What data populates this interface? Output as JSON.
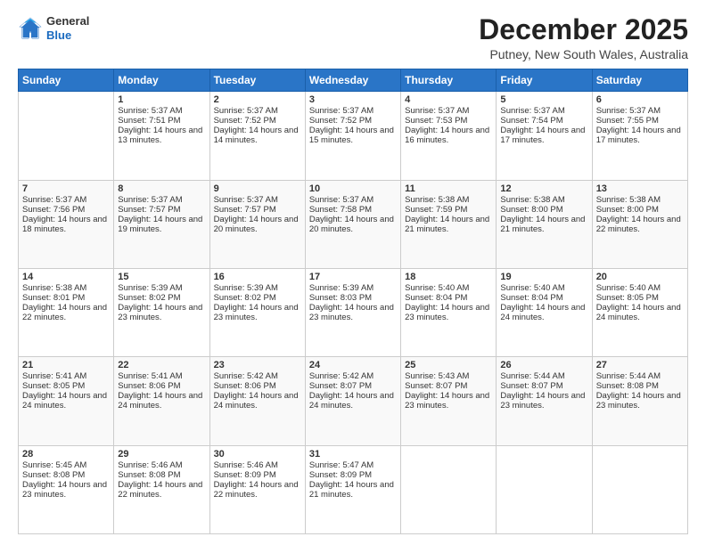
{
  "logo": {
    "general": "General",
    "blue": "Blue"
  },
  "title": "December 2025",
  "subtitle": "Putney, New South Wales, Australia",
  "days": [
    "Sunday",
    "Monday",
    "Tuesday",
    "Wednesday",
    "Thursday",
    "Friday",
    "Saturday"
  ],
  "weeks": [
    [
      {
        "day": "",
        "sunrise": "",
        "sunset": "",
        "daylight": ""
      },
      {
        "day": "1",
        "sunrise": "Sunrise: 5:37 AM",
        "sunset": "Sunset: 7:51 PM",
        "daylight": "Daylight: 14 hours and 13 minutes."
      },
      {
        "day": "2",
        "sunrise": "Sunrise: 5:37 AM",
        "sunset": "Sunset: 7:52 PM",
        "daylight": "Daylight: 14 hours and 14 minutes."
      },
      {
        "day": "3",
        "sunrise": "Sunrise: 5:37 AM",
        "sunset": "Sunset: 7:52 PM",
        "daylight": "Daylight: 14 hours and 15 minutes."
      },
      {
        "day": "4",
        "sunrise": "Sunrise: 5:37 AM",
        "sunset": "Sunset: 7:53 PM",
        "daylight": "Daylight: 14 hours and 16 minutes."
      },
      {
        "day": "5",
        "sunrise": "Sunrise: 5:37 AM",
        "sunset": "Sunset: 7:54 PM",
        "daylight": "Daylight: 14 hours and 17 minutes."
      },
      {
        "day": "6",
        "sunrise": "Sunrise: 5:37 AM",
        "sunset": "Sunset: 7:55 PM",
        "daylight": "Daylight: 14 hours and 17 minutes."
      }
    ],
    [
      {
        "day": "7",
        "sunrise": "Sunrise: 5:37 AM",
        "sunset": "Sunset: 7:56 PM",
        "daylight": "Daylight: 14 hours and 18 minutes."
      },
      {
        "day": "8",
        "sunrise": "Sunrise: 5:37 AM",
        "sunset": "Sunset: 7:57 PM",
        "daylight": "Daylight: 14 hours and 19 minutes."
      },
      {
        "day": "9",
        "sunrise": "Sunrise: 5:37 AM",
        "sunset": "Sunset: 7:57 PM",
        "daylight": "Daylight: 14 hours and 20 minutes."
      },
      {
        "day": "10",
        "sunrise": "Sunrise: 5:37 AM",
        "sunset": "Sunset: 7:58 PM",
        "daylight": "Daylight: 14 hours and 20 minutes."
      },
      {
        "day": "11",
        "sunrise": "Sunrise: 5:38 AM",
        "sunset": "Sunset: 7:59 PM",
        "daylight": "Daylight: 14 hours and 21 minutes."
      },
      {
        "day": "12",
        "sunrise": "Sunrise: 5:38 AM",
        "sunset": "Sunset: 8:00 PM",
        "daylight": "Daylight: 14 hours and 21 minutes."
      },
      {
        "day": "13",
        "sunrise": "Sunrise: 5:38 AM",
        "sunset": "Sunset: 8:00 PM",
        "daylight": "Daylight: 14 hours and 22 minutes."
      }
    ],
    [
      {
        "day": "14",
        "sunrise": "Sunrise: 5:38 AM",
        "sunset": "Sunset: 8:01 PM",
        "daylight": "Daylight: 14 hours and 22 minutes."
      },
      {
        "day": "15",
        "sunrise": "Sunrise: 5:39 AM",
        "sunset": "Sunset: 8:02 PM",
        "daylight": "Daylight: 14 hours and 23 minutes."
      },
      {
        "day": "16",
        "sunrise": "Sunrise: 5:39 AM",
        "sunset": "Sunset: 8:02 PM",
        "daylight": "Daylight: 14 hours and 23 minutes."
      },
      {
        "day": "17",
        "sunrise": "Sunrise: 5:39 AM",
        "sunset": "Sunset: 8:03 PM",
        "daylight": "Daylight: 14 hours and 23 minutes."
      },
      {
        "day": "18",
        "sunrise": "Sunrise: 5:40 AM",
        "sunset": "Sunset: 8:04 PM",
        "daylight": "Daylight: 14 hours and 23 minutes."
      },
      {
        "day": "19",
        "sunrise": "Sunrise: 5:40 AM",
        "sunset": "Sunset: 8:04 PM",
        "daylight": "Daylight: 14 hours and 24 minutes."
      },
      {
        "day": "20",
        "sunrise": "Sunrise: 5:40 AM",
        "sunset": "Sunset: 8:05 PM",
        "daylight": "Daylight: 14 hours and 24 minutes."
      }
    ],
    [
      {
        "day": "21",
        "sunrise": "Sunrise: 5:41 AM",
        "sunset": "Sunset: 8:05 PM",
        "daylight": "Daylight: 14 hours and 24 minutes."
      },
      {
        "day": "22",
        "sunrise": "Sunrise: 5:41 AM",
        "sunset": "Sunset: 8:06 PM",
        "daylight": "Daylight: 14 hours and 24 minutes."
      },
      {
        "day": "23",
        "sunrise": "Sunrise: 5:42 AM",
        "sunset": "Sunset: 8:06 PM",
        "daylight": "Daylight: 14 hours and 24 minutes."
      },
      {
        "day": "24",
        "sunrise": "Sunrise: 5:42 AM",
        "sunset": "Sunset: 8:07 PM",
        "daylight": "Daylight: 14 hours and 24 minutes."
      },
      {
        "day": "25",
        "sunrise": "Sunrise: 5:43 AM",
        "sunset": "Sunset: 8:07 PM",
        "daylight": "Daylight: 14 hours and 23 minutes."
      },
      {
        "day": "26",
        "sunrise": "Sunrise: 5:44 AM",
        "sunset": "Sunset: 8:07 PM",
        "daylight": "Daylight: 14 hours and 23 minutes."
      },
      {
        "day": "27",
        "sunrise": "Sunrise: 5:44 AM",
        "sunset": "Sunset: 8:08 PM",
        "daylight": "Daylight: 14 hours and 23 minutes."
      }
    ],
    [
      {
        "day": "28",
        "sunrise": "Sunrise: 5:45 AM",
        "sunset": "Sunset: 8:08 PM",
        "daylight": "Daylight: 14 hours and 23 minutes."
      },
      {
        "day": "29",
        "sunrise": "Sunrise: 5:46 AM",
        "sunset": "Sunset: 8:08 PM",
        "daylight": "Daylight: 14 hours and 22 minutes."
      },
      {
        "day": "30",
        "sunrise": "Sunrise: 5:46 AM",
        "sunset": "Sunset: 8:09 PM",
        "daylight": "Daylight: 14 hours and 22 minutes."
      },
      {
        "day": "31",
        "sunrise": "Sunrise: 5:47 AM",
        "sunset": "Sunset: 8:09 PM",
        "daylight": "Daylight: 14 hours and 21 minutes."
      },
      {
        "day": "",
        "sunrise": "",
        "sunset": "",
        "daylight": ""
      },
      {
        "day": "",
        "sunrise": "",
        "sunset": "",
        "daylight": ""
      },
      {
        "day": "",
        "sunrise": "",
        "sunset": "",
        "daylight": ""
      }
    ]
  ]
}
